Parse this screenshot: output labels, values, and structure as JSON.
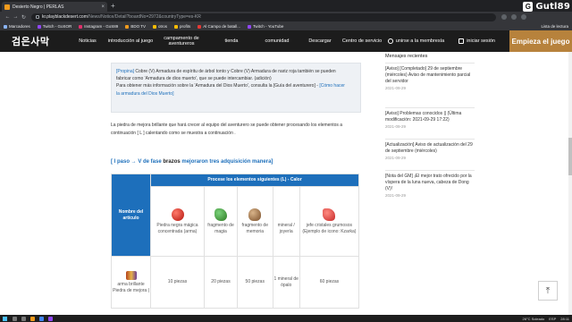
{
  "browser": {
    "tab_title": "Desierto Negro | PERLAS",
    "url_domain": "kr.playblackdesert.com",
    "url_path": "/News/Notice/Detail?boardNo=2972&countryType=es-KR",
    "bookmarks": [
      "Marcadores",
      "Twitch - GoSOR",
      "Instagram - GoS89",
      "BDO TV",
      "otros",
      "profits",
      "Al Campo de batall...",
      "Twitch - YouTube"
    ],
    "reading_list": "Lista de lectura"
  },
  "watermark": "Gutl89",
  "header": {
    "logo": "검은사막",
    "nav": [
      "Noticias",
      "introducción al juego",
      "campamento de aventureros",
      "tienda",
      "comunidad",
      "Descargar",
      "Centro de servicio"
    ],
    "join": "unirse a la membresía",
    "login": "iniciar sesión",
    "cta": "Empieza el juego"
  },
  "article": {
    "info_l1a": "[Propina]",
    "info_l1b": " Cobre (V) Armadura de espíritu de árbol tonto y Cobre (V) Armadura de nariz roja también se pueden",
    "info_l2": "fabricar como 'Armadura de dios muerto', que se puede intercambiar. (adición)",
    "info_l3a": "Para obtener más información sobre la 'Armadura del Dios Muerto', consulta la [Guía del aventurero] - ",
    "info_l3b": "[Cómo hacer",
    "info_l4": "la armadura del Dios Muerto]",
    "para_l1": "La piedra de mejora brillante que hará crecer al equipo del aventurero se puede obtener procesando los elementos a",
    "para_l2": "continuación [ L ] calentando como se muestra a continuación .",
    "sub_a": "[ l paso → V de fase  ",
    "sub_b": "brazos",
    "sub_c": " mejoraron tres adquisición manera]"
  },
  "table": {
    "header_item": "Nombre del artículo",
    "header_process": "Procese los elementos siguientes (L) - Calor",
    "items": [
      {
        "name": "Piedra negra mágica concentrada (arma)",
        "icon": "red-gem-icon"
      },
      {
        "name": "fragmento de magia",
        "icon": "green-fragment-icon"
      },
      {
        "name": "fragmento de memoria",
        "icon": "memory-fragment-icon"
      },
      {
        "name": "mineral / joyería",
        "icon": "none"
      },
      {
        "name": "jefe cristales grumosos (Ejemplo de icono: Kzarka)",
        "icon": "crystal-icon"
      }
    ],
    "row": {
      "name": "arma brillante Piedra de mejora |",
      "icon": "armor-stone-icon",
      "values": [
        "10 piezas",
        "20 piezas",
        "50 piezas",
        "1 mineral de ópalo",
        "60 piezas"
      ]
    }
  },
  "sidebar": {
    "title": "Mensajes recientes",
    "items": [
      {
        "text": "[Aviso] [Completado] 29 de septiembre (miércoles) Aviso de mantenimiento parcial del servidor",
        "date": "2021-09-29"
      },
      {
        "text": "[Aviso] Problemas conocidos || (Última modificación: 2021-09-29 17:22)",
        "date": "2021-09-29"
      },
      {
        "text": "[Actualización] Aviso de actualización del 29 de septiembre (miércoles)",
        "date": "2021-09-29"
      },
      {
        "text": "[Nota del GM] ¡El mejor trato ofrecido por la víspera de la luna nueva, cabeza de Dong (V)!",
        "date": "2021-09-29"
      }
    ]
  },
  "taskbar": {
    "weather": "26°C Soleado",
    "lang": "ESP",
    "time": "28:11"
  }
}
